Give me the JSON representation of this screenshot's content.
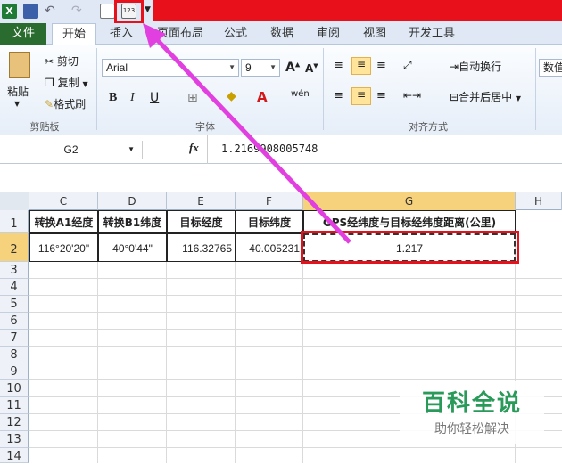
{
  "ribbon_tabs": [
    "文件",
    "开始",
    "插入",
    "页面布局",
    "公式",
    "数据",
    "审阅",
    "视图",
    "开发工具"
  ],
  "clipboard": {
    "paste": "粘贴",
    "cut": "剪切",
    "copy": "复制",
    "format_painter": "格式刷",
    "group": "剪贴板"
  },
  "font": {
    "name": "Arial",
    "size": "9",
    "group": "字体"
  },
  "alignment": {
    "wrap": "自动换行",
    "merge": "合并后居中",
    "group": "对齐方式"
  },
  "number": {
    "label": "数值"
  },
  "formula_bar": {
    "name_box": "G2",
    "fx": "fx",
    "value": "1.2169908005748"
  },
  "columns": [
    "C",
    "D",
    "E",
    "F",
    "G",
    "H"
  ],
  "rows": [
    "1",
    "2",
    "3",
    "4",
    "5",
    "6",
    "7",
    "8",
    "9",
    "10",
    "11",
    "12",
    "13",
    "14"
  ],
  "headers": [
    "转换A1经度",
    "转换B1纬度",
    "目标经度",
    "目标纬度",
    "GPS经纬度与目标经纬度距离(公里)"
  ],
  "row2": [
    "116°20'20\"",
    "40°0'44\"",
    "116.32765",
    "40.005231",
    "1.217"
  ],
  "watermark": {
    "title": "百科全说",
    "subtitle": "助你轻松解决"
  }
}
